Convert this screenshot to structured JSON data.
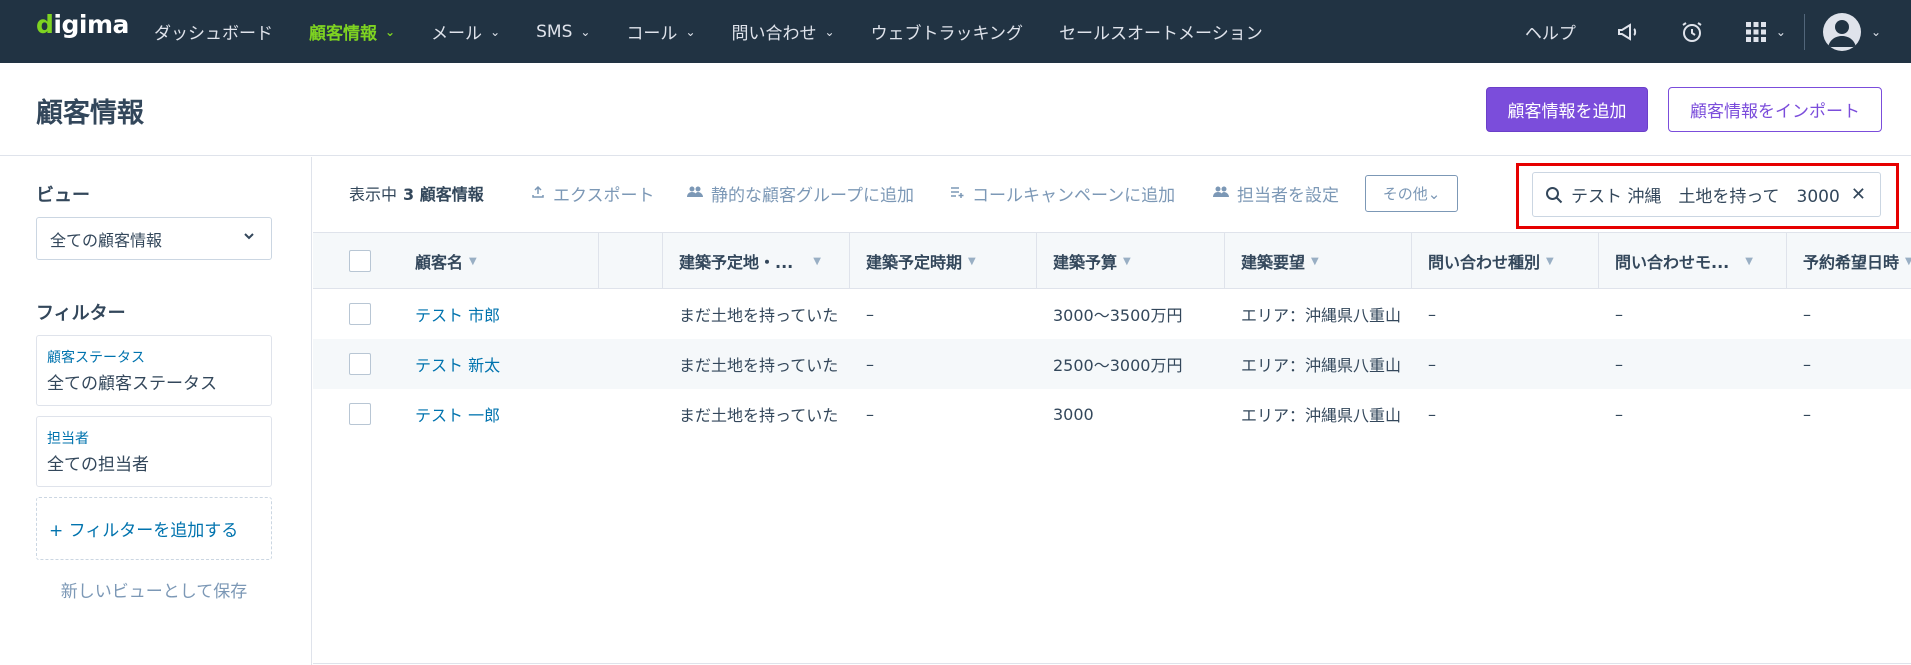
{
  "app": {
    "logo": "digima"
  },
  "nav": {
    "items": [
      {
        "label": "ダッシュボード",
        "chevron": false,
        "active": false
      },
      {
        "label": "顧客情報",
        "chevron": true,
        "active": true
      },
      {
        "label": "メール",
        "chevron": true,
        "active": false
      },
      {
        "label": "SMS",
        "chevron": true,
        "active": false
      },
      {
        "label": "コール",
        "chevron": true,
        "active": false
      },
      {
        "label": "問い合わせ",
        "chevron": true,
        "active": false
      },
      {
        "label": "ウェブトラッキング",
        "chevron": false,
        "active": false
      },
      {
        "label": "セールスオートメーション",
        "chevron": false,
        "active": false
      }
    ],
    "help": "ヘルプ",
    "chevron_glyph": "⌄"
  },
  "header": {
    "title": "顧客情報",
    "add_button": "顧客情報を追加",
    "import_button": "顧客情報をインポート"
  },
  "sidebar": {
    "view_label": "ビュー",
    "view_selected": "全ての顧客情報",
    "filter_label": "フィルター",
    "filters": [
      {
        "label": "顧客ステータス",
        "value": "全ての顧客ステータス"
      },
      {
        "label": "担当者",
        "value": "全ての担当者"
      }
    ],
    "add_filter": "+  フィルターを追加する",
    "save_view": "新しいビューとして保存"
  },
  "toolbar": {
    "count_prefix": "表示中",
    "count_value": "3 顧客情報",
    "export": "エクスポート",
    "add_static_group": "静的な顧客グループに追加",
    "add_call_campaign": "コールキャンペーンに追加",
    "set_owner": "担当者を設定",
    "other": "その他⌄"
  },
  "search": {
    "value": "テスト 沖縄　土地を持って　3000",
    "clear": "✕"
  },
  "table": {
    "columns": [
      "顧客名",
      "",
      "建築予定地・...",
      "建築予定時期",
      "建築予算",
      "建築要望",
      "問い合わせ種別",
      "問い合わせモ...",
      "予約希望日時"
    ],
    "rows": [
      [
        "テスト 市郎",
        "",
        "まだ土地を持っていた",
        "–",
        "3000～3500万円",
        "エリア：沖縄県八重山",
        "–",
        "–",
        "–"
      ],
      [
        "テスト 新太",
        "",
        "まだ土地を持っていた",
        "–",
        "2500～3000万円",
        "エリア：沖縄県八重山",
        "–",
        "–",
        "–"
      ],
      [
        "テスト 一郎",
        "",
        "まだ土地を持っていた",
        "–",
        "3000",
        "エリア：沖縄県八重山",
        "–",
        "–",
        "–"
      ]
    ]
  },
  "colors": {
    "nav_bg": "#213343",
    "accent_green": "#7ed321",
    "primary_purple": "#7b4ddb",
    "link_blue": "#0073ae",
    "highlight_red": "#e60000"
  },
  "icons": {
    "announcement": "megaphone-icon",
    "alarm": "alarm-clock-icon",
    "apps": "grid-icon",
    "search": "search-icon"
  }
}
